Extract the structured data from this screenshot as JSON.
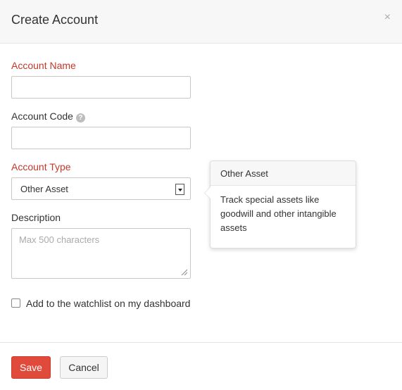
{
  "dialog": {
    "title": "Create Account",
    "close_icon": "close-icon",
    "close_symbol": "×"
  },
  "form": {
    "account_name": {
      "label": "Account Name",
      "required": true,
      "value": ""
    },
    "account_code": {
      "label": "Account Code",
      "help_icon": "question-circle-icon",
      "help_symbol": "?",
      "value": ""
    },
    "account_type": {
      "label": "Account Type",
      "required": true,
      "selected": "Other Asset"
    },
    "description": {
      "label": "Description",
      "placeholder": "Max 500 characters",
      "value": ""
    },
    "watchlist": {
      "label": "Add to the watchlist on my dashboard",
      "checked": false
    }
  },
  "tooltip": {
    "title": "Other Asset",
    "body": "Track special assets like goodwill and other intangible assets"
  },
  "footer": {
    "save_label": "Save",
    "cancel_label": "Cancel"
  },
  "colors": {
    "required_label": "#c0392b",
    "primary_button": "#e04a3a"
  }
}
